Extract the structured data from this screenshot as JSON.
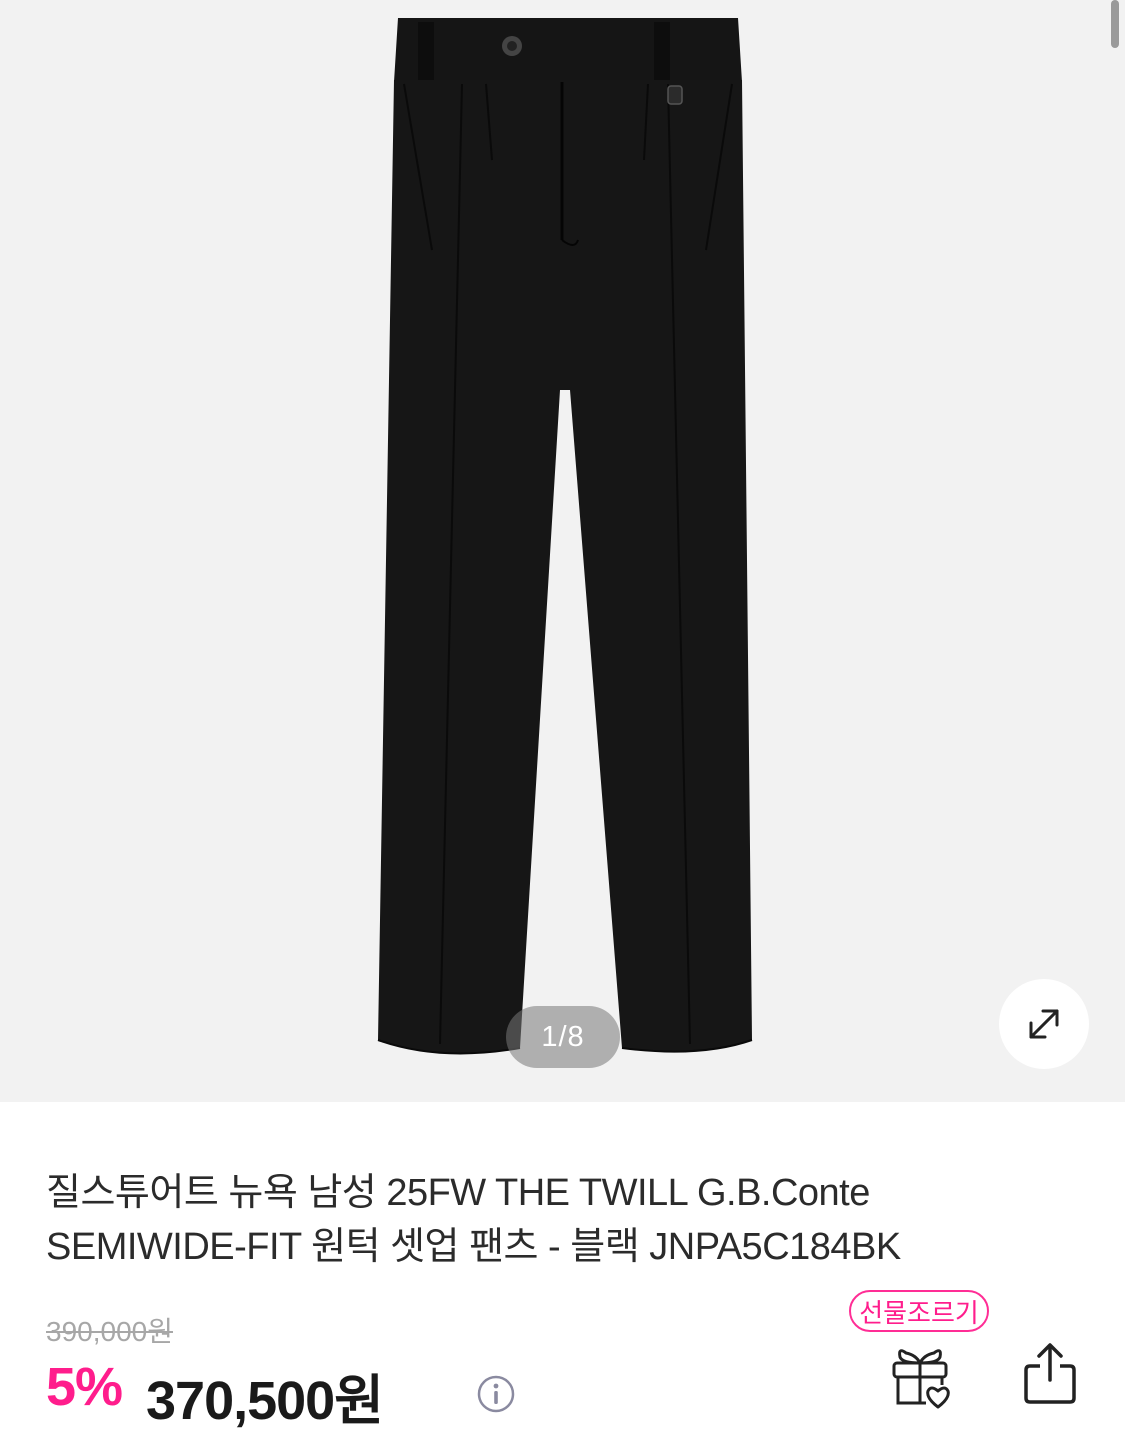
{
  "gallery": {
    "image_alt": "black wide-fit pleated trousers",
    "counter": "1/8",
    "expand_icon": "expand-arrows-icon"
  },
  "product": {
    "title": "질스튜어트 뉴욕 남성 25FW THE TWILL G.B.Conte SEMIWIDE-FIT 원턱 셋업 팬츠 - 블랙 JNPA5C184BK",
    "original_price": "390,000원",
    "discount": "5%",
    "sale_price": "370,500원",
    "info_icon": "info-icon"
  },
  "actions": {
    "gift_badge": "선물조르기",
    "gift_icon": "gift-heart-icon",
    "share_icon": "share-icon"
  },
  "colors": {
    "accent": "#ff1d8c",
    "gallery_bg": "#f2f2f2"
  }
}
